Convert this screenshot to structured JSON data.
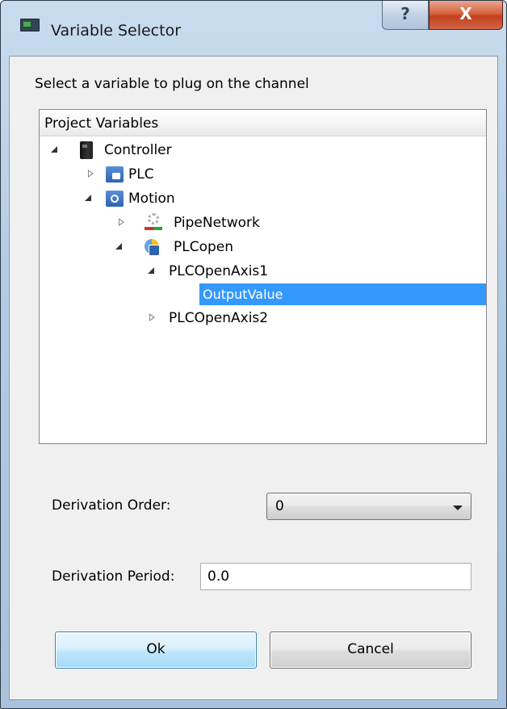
{
  "window": {
    "title": "Variable Selector",
    "help_label": "?",
    "close_label": "X"
  },
  "dialog": {
    "instruction": "Select a variable to plug on the channel"
  },
  "tree": {
    "header": "Project Variables",
    "nodes": [
      {
        "label": "Controller",
        "icon": "controller-icon",
        "expanded": true
      },
      {
        "label": "PLC",
        "icon": "plc-icon",
        "expanded": false
      },
      {
        "label": "Motion",
        "icon": "motion-icon",
        "expanded": true
      },
      {
        "label": "PipeNetwork",
        "icon": "pipe-network-icon",
        "expanded": false
      },
      {
        "label": "PLCopen",
        "icon": "plcopen-icon",
        "expanded": true
      },
      {
        "label": "PLCOpenAxis1",
        "expanded": true
      },
      {
        "label": "OutputValue",
        "selected": true
      },
      {
        "label": "PLCOpenAxis2",
        "expanded": false
      }
    ]
  },
  "derivation_order": {
    "label": "Derivation Order:",
    "value": "0"
  },
  "derivation_period": {
    "label": "Derivation Period:",
    "value": "0.0"
  },
  "buttons": {
    "ok": "Ok",
    "cancel": "Cancel"
  },
  "colors": {
    "selection": "#3399ff",
    "close_button": "#c2411c",
    "frame": "#b3cbe3"
  }
}
